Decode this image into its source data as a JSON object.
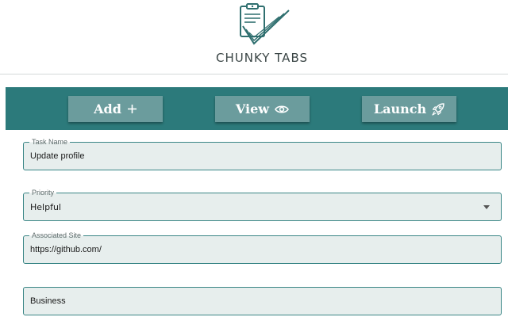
{
  "brand": {
    "name": "CHUNKY TABS",
    "logo_icon": "clipboard-check-icon"
  },
  "toolbar": {
    "add_label": "Add",
    "add_icon": "plus-icon",
    "view_label": "View",
    "view_icon": "eye-icon",
    "launch_label": "Launch",
    "launch_icon": "rocket-icon",
    "background_color": "#2c7a7b",
    "button_color": "#6b9c9d"
  },
  "form": {
    "task_name": {
      "label": "Task Name",
      "value": "Update profile"
    },
    "priority": {
      "label": "Priority",
      "value": "Helpful",
      "icon": "caret-down-icon"
    },
    "associated_site": {
      "label": "Associated Site",
      "value": "https://github.com/"
    },
    "category": {
      "value": "Business"
    }
  },
  "colors": {
    "accent": "#2c7a7b",
    "field_background": "#e7eeed",
    "field_border": "#3a8686",
    "text": "#1a1a1a"
  }
}
